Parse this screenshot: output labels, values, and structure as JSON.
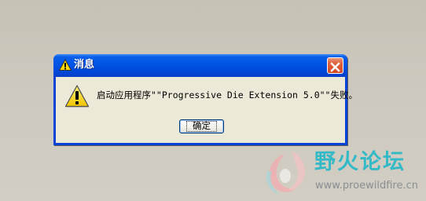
{
  "dialog": {
    "title": "消息",
    "message": "启动应用程序\"\"Progressive Die Extension 5.0\"\"失败。",
    "ok_label": "确定",
    "icons": {
      "title": "warning-icon",
      "body": "warning-icon",
      "close": "close-icon"
    }
  },
  "watermark": {
    "title": "野火论坛",
    "url": "www.proewildfire.cn",
    "icon": "flame-logo-icon"
  },
  "colors": {
    "titlebar": "#0055e5",
    "close_button": "#e0623d",
    "dialog_body": "#ece9d8",
    "desktop": "#ccc8bd",
    "watermark_text": "#34b9c7"
  }
}
